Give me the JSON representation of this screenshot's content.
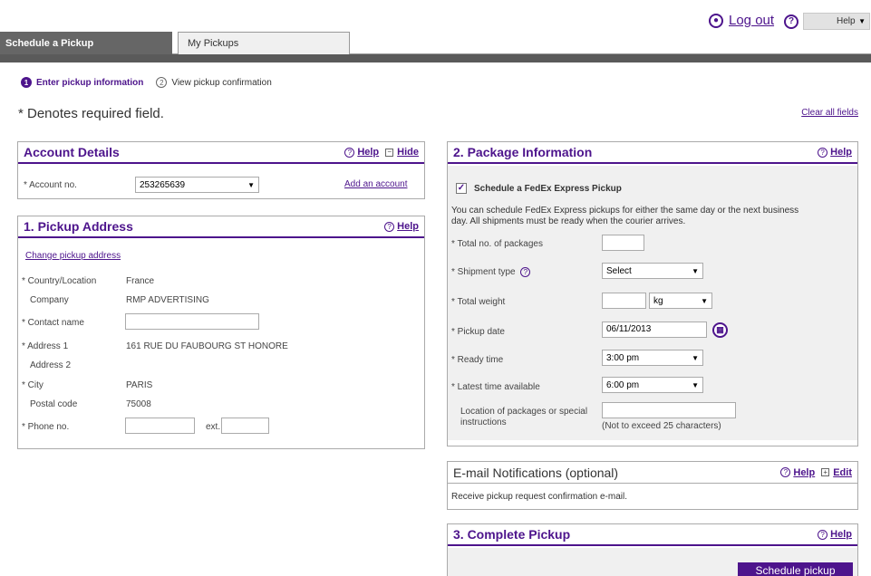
{
  "header": {
    "logout_label": "Log out",
    "help_label": "Help"
  },
  "tabs": [
    {
      "label": "Schedule a Pickup",
      "active": true
    },
    {
      "label": "My Pickups",
      "active": false
    }
  ],
  "steps": [
    {
      "num": "1",
      "label": "Enter pickup information",
      "current": true
    },
    {
      "num": "2",
      "label": "View pickup confirmation",
      "current": false
    }
  ],
  "required_note": "* Denotes required field.",
  "clear_all_label": "Clear all fields",
  "account": {
    "title": "Account Details",
    "help_label": "Help",
    "hide_label": "Hide",
    "account_label": "* Account no.",
    "account_value": "253265639",
    "add_account_label": "Add an account"
  },
  "address": {
    "title": "1. Pickup Address",
    "help_label": "Help",
    "change_label": "Change pickup address",
    "country_label": "* Country/Location",
    "country_value": "France",
    "company_label": "Company",
    "company_value": "RMP ADVERTISING",
    "contact_label": "* Contact name",
    "contact_value": "",
    "address1_label": "* Address 1",
    "address1_value": "161 RUE DU FAUBOURG ST HONORE",
    "address2_label": "Address 2",
    "address2_value": "",
    "city_label": "* City",
    "city_value": "PARIS",
    "postal_label": "Postal code",
    "postal_value": "75008",
    "phone_label": "* Phone no.",
    "phone_value": "",
    "ext_label": "ext.",
    "ext_value": ""
  },
  "package": {
    "title": "2. Package Information",
    "help_label": "Help",
    "express_label": "Schedule a FedEx Express Pickup",
    "express_checked": true,
    "info_line1": "You can schedule FedEx Express pickups for either the same day or the next business",
    "info_line2": "day. All shipments must be ready when the courier arrives.",
    "total_packages_label": "* Total no. of packages",
    "total_packages_value": "",
    "shipment_type_label": "* Shipment type",
    "shipment_type_value": "Select",
    "total_weight_label": "* Total weight",
    "total_weight_value": "",
    "weight_unit_value": "kg",
    "pickup_date_label": "* Pickup date",
    "pickup_date_value": "06/11/2013",
    "ready_time_label": "* Ready time",
    "ready_time_value": "3:00 pm",
    "latest_time_label": "* Latest time available",
    "latest_time_value": "6:00 pm",
    "location_label_line1": "Location of packages or special",
    "location_label_line2": "instructions",
    "location_value": "",
    "location_note": "(Not to exceed 25 characters)"
  },
  "email": {
    "title": "E-mail Notifications (optional)",
    "help_label": "Help",
    "edit_label": "Edit",
    "body_text": "Receive pickup request confirmation e-mail."
  },
  "complete": {
    "title": "3. Complete Pickup",
    "help_label": "Help",
    "schedule_label": "Schedule pickup"
  },
  "colors": {
    "brand_purple": "#4d148c",
    "tab_dark": "#666666",
    "panel_bg": "#f0f0f0"
  },
  "icons": [
    "lock-icon",
    "question-icon",
    "chevron-down-icon",
    "collapse-icon",
    "expand-icon",
    "calendar-icon",
    "checkbox-icon"
  ]
}
